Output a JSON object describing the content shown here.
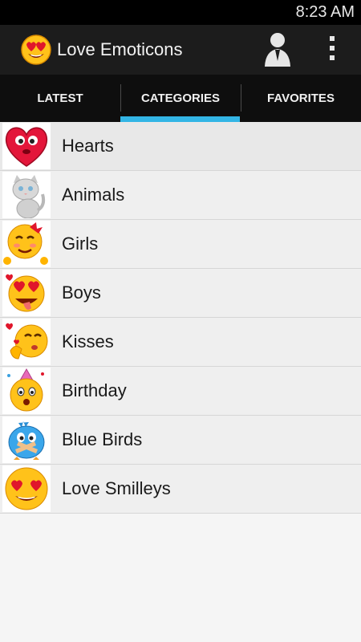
{
  "status_bar": {
    "time": "8:23 AM"
  },
  "action_bar": {
    "title": "Love Emoticons",
    "app_icon": "heart-eyes-smiley-icon",
    "profile_icon": "person-silhouette-icon",
    "overflow_icon": "overflow-menu-icon"
  },
  "tabs": [
    {
      "label": "LATEST",
      "selected": false
    },
    {
      "label": "CATEGORIES",
      "selected": true
    },
    {
      "label": "FAVORITES",
      "selected": false
    }
  ],
  "colors": {
    "accent": "#33b5e5",
    "action_bar": "#1c1c1c",
    "tab_bar": "#0e0e0e",
    "list_bg": "#efefef"
  },
  "categories": [
    {
      "label": "Hearts",
      "icon": "heart-face-icon"
    },
    {
      "label": "Animals",
      "icon": "kitten-icon"
    },
    {
      "label": "Girls",
      "icon": "girl-smiley-icon"
    },
    {
      "label": "Boys",
      "icon": "boy-smiley-icon"
    },
    {
      "label": "Kisses",
      "icon": "kissing-smiley-icon"
    },
    {
      "label": "Birthday",
      "icon": "birthday-smiley-icon"
    },
    {
      "label": "Blue Birds",
      "icon": "blue-bird-icon"
    },
    {
      "label": "Love Smilleys",
      "icon": "love-smiley-icon"
    }
  ]
}
